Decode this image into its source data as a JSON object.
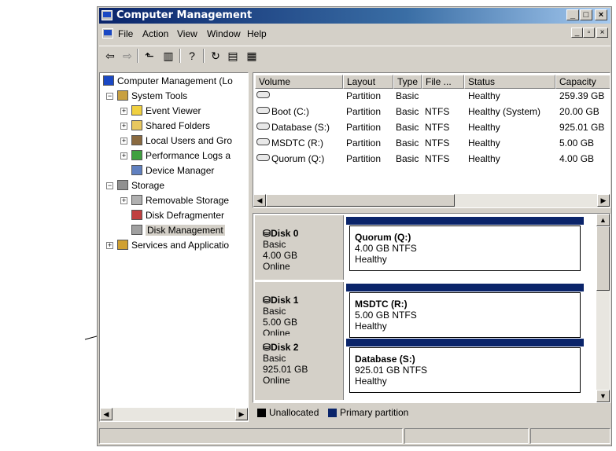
{
  "window": {
    "title": "Computer Management"
  },
  "menu": [
    "File",
    "Action",
    "View",
    "Window",
    "Help"
  ],
  "tree": {
    "root": "Computer Management (Lo",
    "system_tools": "System Tools",
    "event_viewer": "Event Viewer",
    "shared_folders": "Shared Folders",
    "local_users": "Local Users and Gro",
    "perf_logs": "Performance Logs a",
    "device_manager": "Device Manager",
    "storage": "Storage",
    "removable_storage": "Removable Storage",
    "disk_defrag": "Disk Defragmenter",
    "disk_mgmt": "Disk Management",
    "services": "Services and Applicatio"
  },
  "volumes": {
    "headers": [
      "Volume",
      "Layout",
      "Type",
      "File ...",
      "Status",
      "Capacity"
    ],
    "rows": [
      [
        "",
        "Partition",
        "Basic",
        "",
        "Healthy",
        "259.39 GB"
      ],
      [
        "Boot (C:)",
        "Partition",
        "Basic",
        "NTFS",
        "Healthy (System)",
        "20.00 GB"
      ],
      [
        "Database (S:)",
        "Partition",
        "Basic",
        "NTFS",
        "Healthy",
        "925.01 GB"
      ],
      [
        "MSDTC (R:)",
        "Partition",
        "Basic",
        "NTFS",
        "Healthy",
        "5.00 GB"
      ],
      [
        "Quorum (Q:)",
        "Partition",
        "Basic",
        "NTFS",
        "Healthy",
        "4.00 GB"
      ]
    ]
  },
  "disks": [
    {
      "name": "Disk 0",
      "type": "Basic",
      "size": "4.00 GB",
      "state": "Online",
      "vol_name": "Quorum  (Q:)",
      "vol_fs": "4.00 GB NTFS",
      "vol_status": "Healthy"
    },
    {
      "name": "Disk 1",
      "type": "Basic",
      "size": "5.00 GB",
      "state": "Online",
      "vol_name": "MSDTC  (R:)",
      "vol_fs": "5.00 GB NTFS",
      "vol_status": "Healthy"
    },
    {
      "name": "Disk 2",
      "type": "Basic",
      "size": "925.01 GB",
      "state": "Online",
      "vol_name": "Database  (S:)",
      "vol_fs": "925.01 GB NTFS",
      "vol_status": "Healthy"
    }
  ],
  "legend": {
    "unallocated": "Unallocated",
    "unallocated_color": "#000000",
    "primary": "Primary partition",
    "primary_color": "#0a246a"
  },
  "colors": {
    "title_bar": "#0a246a",
    "chrome": "#d4d0c8"
  }
}
